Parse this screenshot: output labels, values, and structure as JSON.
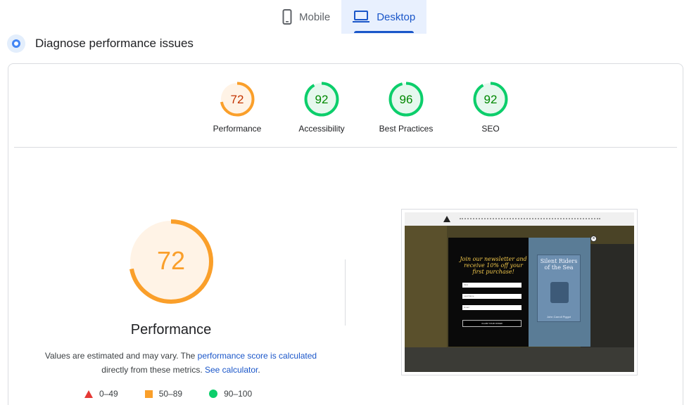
{
  "tabs": [
    {
      "label": "Mobile",
      "icon": "phone-icon",
      "active": false
    },
    {
      "label": "Desktop",
      "icon": "laptop-icon",
      "active": true
    }
  ],
  "section": {
    "title": "Diagnose performance issues"
  },
  "categories": [
    {
      "label": "Performance",
      "score": "72",
      "value": 72,
      "status": "average"
    },
    {
      "label": "Accessibility",
      "score": "92",
      "value": 92,
      "status": "pass"
    },
    {
      "label": "Best Practices",
      "score": "96",
      "value": 96,
      "status": "pass"
    },
    {
      "label": "SEO",
      "score": "92",
      "value": 92,
      "status": "pass"
    }
  ],
  "performance": {
    "score": "72",
    "value": 72,
    "title": "Performance",
    "desc_prefix": "Values are estimated and may vary. The ",
    "desc_link": "performance score is calculated",
    "desc_middle": "directly from these metrics. ",
    "desc_link2": "See calculator",
    "desc_suffix": "."
  },
  "legend": [
    {
      "range": "0–49",
      "shape": "triangle",
      "color": "#e53935"
    },
    {
      "range": "50–89",
      "shape": "square",
      "color": "#fa9f2a"
    },
    {
      "range": "90–100",
      "shape": "circle",
      "color": "#0cce6b"
    }
  ],
  "colors": {
    "accent": "#1a56c9",
    "average": "#fa9f2a",
    "average_text": "#c33300",
    "average_fill": "#fff3e6",
    "pass": "#0cce6b",
    "pass_text": "#008800",
    "pass_fill": "#e6f8ee"
  },
  "screenshot": {
    "promo_text": "Join our newsletter and receive 10% off your first purchase!",
    "field_first": "First",
    "field_last": "Last Name",
    "field_email": "Email",
    "button": "CLAIM YOUR OFFER",
    "book_title": "Silent Riders of the Sea",
    "book_author": "John Carroll Piggot"
  }
}
